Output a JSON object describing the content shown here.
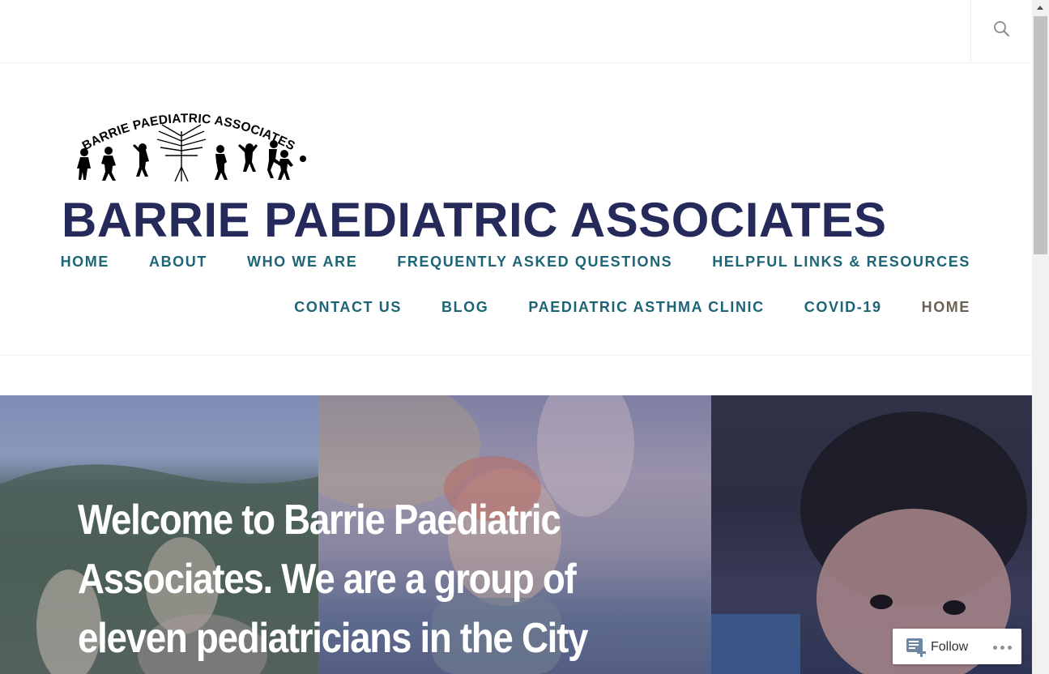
{
  "header": {
    "search_icon": "search-icon",
    "logo": {
      "text": "BARRIE PAEDIATRIC ASSOCIATES",
      "image": "logo-children-silhouettes-tree"
    },
    "site_title": "BARRIE PAEDIATRIC ASSOCIATES"
  },
  "nav": {
    "row1": [
      "HOME",
      "ABOUT",
      "WHO WE ARE",
      "FREQUENTLY ASKED QUESTIONS",
      "HELPFUL LINKS & RESOURCES"
    ],
    "row2": [
      "CONTACT US",
      "BLOG",
      "PAEDIATRIC ASTHMA CLINIC",
      "COVID-19",
      "HOME"
    ]
  },
  "hero": {
    "text": "Welcome to Barrie Paediatric Associates. We are a group of eleven pediatricians in the City"
  },
  "follow_widget": {
    "label": "Follow",
    "icon": "reader-follow-icon",
    "more_icon": "ellipsis-icon"
  },
  "colors": {
    "title": "#262a5a",
    "nav": "#1d6476",
    "nav_last": "#6b6153"
  }
}
